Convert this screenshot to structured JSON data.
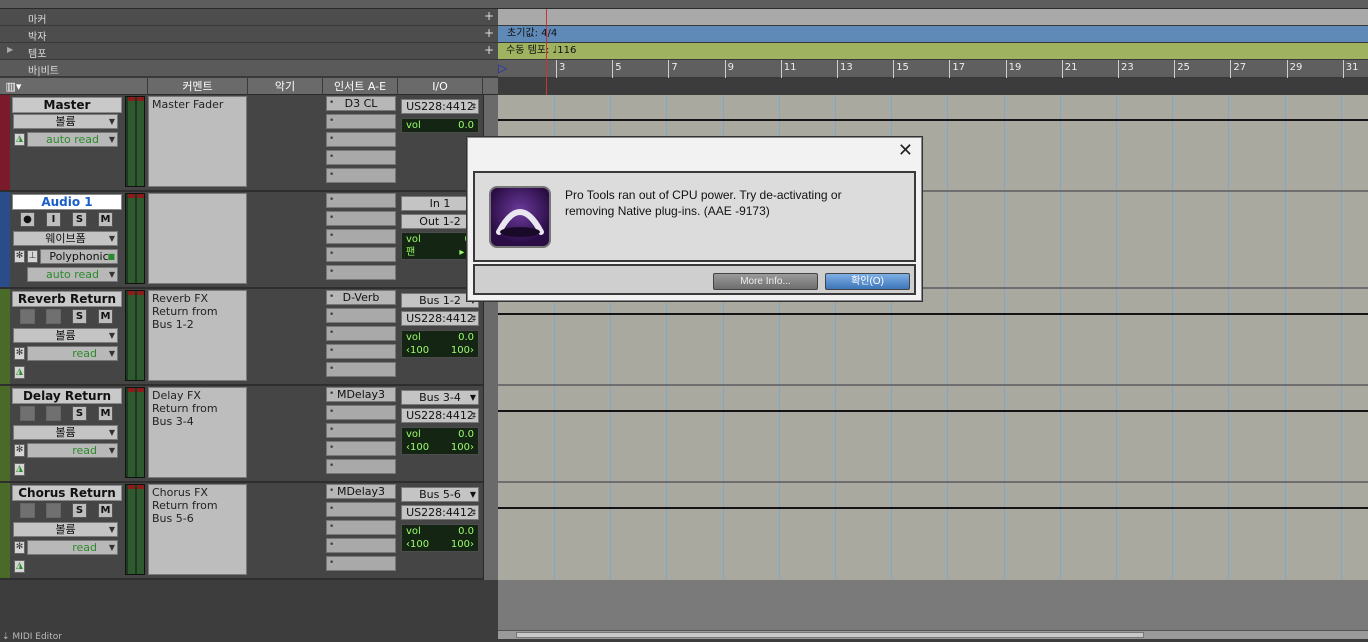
{
  "rulers": {
    "marker": "마커",
    "meter": "박자",
    "tempo": "템포",
    "bars_beats": "바|비트",
    "meter_value": "초기값: 4/4",
    "tempo_value": "수동 템포: ♩116",
    "bar_numbers": [
      "3",
      "5",
      "7",
      "9",
      "11",
      "13",
      "15",
      "17",
      "19",
      "21",
      "23",
      "25",
      "27",
      "29",
      "31"
    ]
  },
  "columns": {
    "comment": "커멘트",
    "instrument": "악기",
    "inserts": "인서트 A-E",
    "io": "I/O"
  },
  "tracks": [
    {
      "name": "Master",
      "comment": "Master Fader",
      "volume_menu": "볼륨",
      "automation": "auto read",
      "insert": "D3 CL",
      "output": "US228:4412",
      "vol_label": "vol",
      "vol_value": "0.0",
      "color": "#7a1a2a"
    },
    {
      "name": "Audio 1",
      "comment": "",
      "view_menu": "웨이브폼",
      "mode": "Polyphonic",
      "automation": "auto read",
      "input": "In 1",
      "output": "Out 1-2",
      "vol_label": "vol",
      "vol_value": "0.",
      "pan_label": "팬",
      "pan_value": "0",
      "rec_label": "",
      "input_label": "I",
      "solo_label": "S",
      "mute_label": "M",
      "color": "#2a4d8a"
    },
    {
      "name": "Reverb Return",
      "comment": "Reverb FX\nReturn from\nBus 1-2",
      "volume_menu": "볼륨",
      "automation": "read",
      "insert": "D-Verb",
      "input": "Bus 1-2",
      "output": "US228:4412",
      "vol_label": "vol",
      "vol_value": "0.0",
      "pan_left": "‹100",
      "pan_right": "100›",
      "solo_label": "S",
      "mute_label": "M",
      "color": "#4a6a2a"
    },
    {
      "name": "Delay Return",
      "comment": "Delay FX\nReturn from\nBus 3-4",
      "volume_menu": "볼륨",
      "automation": "read",
      "insert": "MDelay3",
      "input": "Bus 3-4",
      "output": "US228:4412",
      "vol_label": "vol",
      "vol_value": "0.0",
      "pan_left": "‹100",
      "pan_right": "100›",
      "solo_label": "S",
      "mute_label": "M",
      "color": "#4a6a2a"
    },
    {
      "name": "Chorus Return",
      "comment": "Chorus FX\nReturn from\nBus 5-6",
      "volume_menu": "볼륨",
      "automation": "read",
      "insert": "MDelay3",
      "input": "Bus 5-6",
      "output": "US228:4412",
      "vol_label": "vol",
      "vol_value": "0.0",
      "pan_left": "‹100",
      "pan_right": "100›",
      "solo_label": "S",
      "mute_label": "M",
      "color": "#4a6a2a"
    }
  ],
  "bottom": {
    "midi_editor": "MIDI Editor"
  },
  "dialog": {
    "message_line1": "Pro Tools ran out of CPU power. Try de-activating or",
    "message_line2": "removing Native plug-ins.  (AAE -9173)",
    "more_info": "More Info...",
    "ok": "확인(O)",
    "close": "✕"
  },
  "colors": {
    "meter_lane": "#5f8ab8",
    "tempo_lane": "#9fb25f",
    "ok_button": "#5d90c8",
    "timeline": "#a9a9a0"
  }
}
